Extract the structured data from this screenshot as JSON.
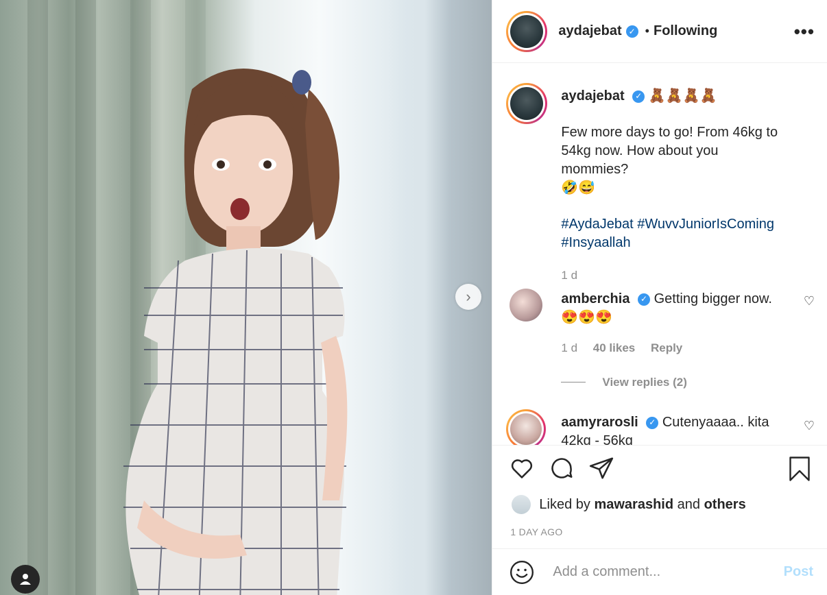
{
  "post": {
    "username": "aydajebat",
    "follow_label": "Following",
    "dot": "•",
    "more": "•••",
    "verified_icon": "✓",
    "caption_emojis": "🧸🧸🧸🧸",
    "caption_line1": "Few more days to go! From 46kg to 54kg now. How about you mommies?",
    "caption_emojis2": "🤣😅",
    "hashtags_line1": "#AydaJebat #WuvvJuniorIsComing",
    "hashtags_line2": "#Insyaallah",
    "caption_time": "1 d"
  },
  "comments": [
    {
      "username": "amberchia",
      "text": "Getting bigger now.",
      "emojis": "😍😍😍",
      "time": "1 d",
      "likes": "40 likes",
      "reply": "Reply",
      "view_replies": "View replies (2)"
    },
    {
      "username": "aamyrarosli",
      "text": "Cutenyaaaa.. kita",
      "text2": "42kg - 56kg"
    }
  ],
  "actions": {
    "liked_prefix": "Liked by",
    "liked_user": "mawarashid",
    "liked_and": "and",
    "liked_others": "others",
    "time_ago": "1 DAY AGO"
  },
  "add_comment": {
    "placeholder": "Add a comment...",
    "post_label": "Post"
  },
  "photo": {
    "next_icon": "›"
  }
}
